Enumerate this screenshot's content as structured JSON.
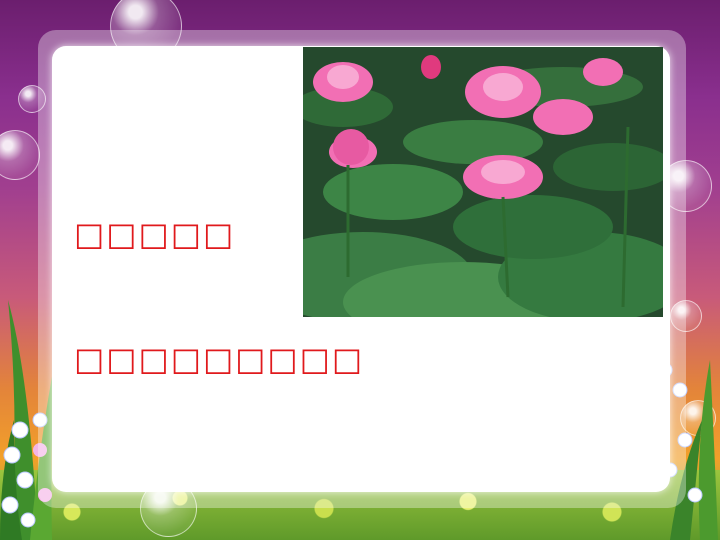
{
  "slide": {
    "line1": "□□□□□",
    "line2": "□□□□□□□□□"
  },
  "photo": {
    "subject": "lotus-pond-photo"
  },
  "colors": {
    "text": "#e0191c",
    "card": "#ffffff",
    "frame_top": "#6b1e6e",
    "frame_bottom": "#f2a02a"
  }
}
